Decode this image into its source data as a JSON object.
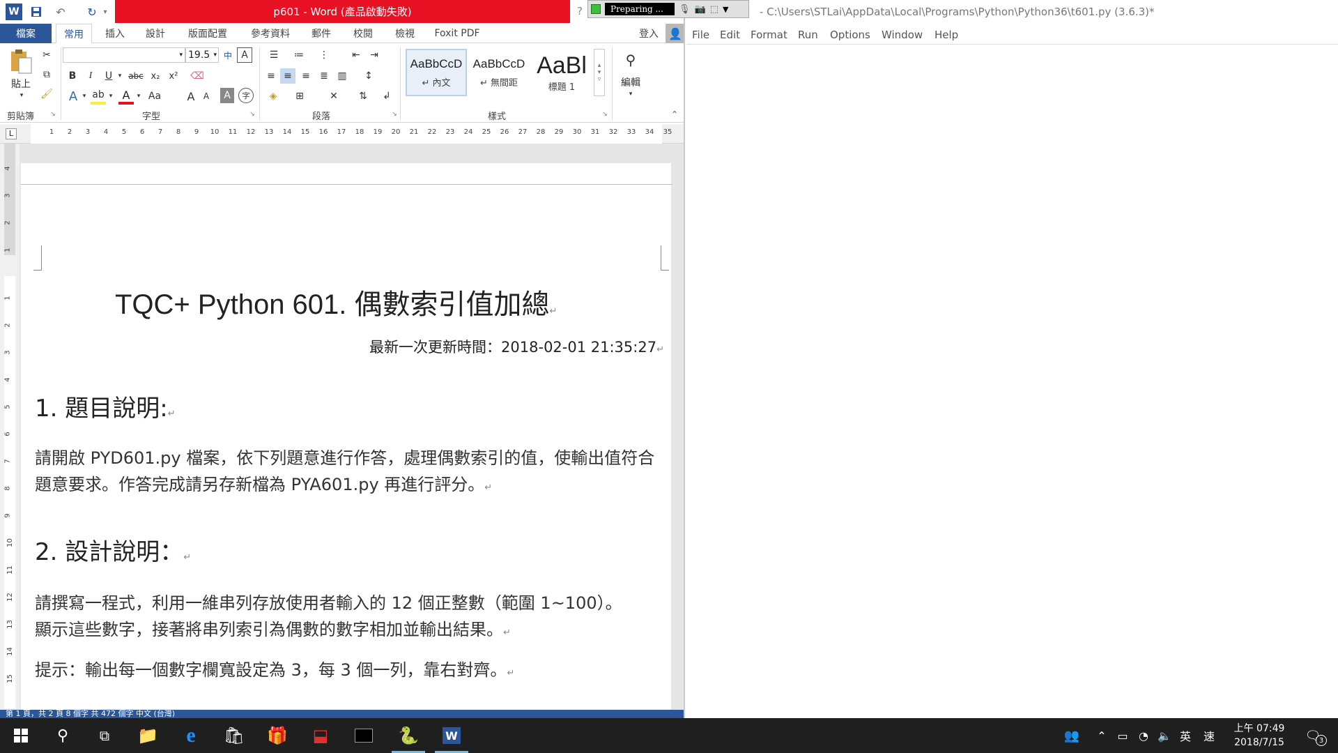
{
  "word": {
    "title": "p601 - Word (產品啟動失敗)",
    "help": "?",
    "tabs": [
      "檔案",
      "常用",
      "插入",
      "設計",
      "版面配置",
      "參考資料",
      "郵件",
      "校閱",
      "檢視",
      "Foxit PDF"
    ],
    "signin": "登入",
    "ribbon": {
      "paste_label": "貼上",
      "clipboard_label": "剪貼簿",
      "font_label": "字型",
      "paragraph_label": "段落",
      "styles_label": "樣式",
      "edit_label": "編輯",
      "font_name": "",
      "font_size": "19.5",
      "bold": "B",
      "italic": "I",
      "underline": "U",
      "strike": "abc",
      "subscript": "x₂",
      "superscript": "x²",
      "grow": "A",
      "shrink": "A",
      "case": "Aa",
      "styles": [
        {
          "sample": "AaBbCcD",
          "name": "↵ 內文"
        },
        {
          "sample": "AaBbCcD",
          "name": "↵ 無間距"
        },
        {
          "sample": "AaBl",
          "name": "標題 1"
        }
      ]
    },
    "ruler_marks": [
      "1",
      "2",
      "3",
      "4",
      "5",
      "6",
      "7",
      "8",
      "9",
      "10",
      "11",
      "12",
      "13",
      "14",
      "15",
      "16",
      "17",
      "18",
      "19",
      "20",
      "21",
      "22",
      "23",
      "24",
      "25",
      "26",
      "27",
      "28",
      "29",
      "30",
      "31",
      "32",
      "33",
      "34",
      "35"
    ],
    "ruler_left_marks": [
      "4",
      "3",
      "2",
      "1",
      "1",
      "2",
      "3",
      "4",
      "5",
      "6",
      "7",
      "8",
      "9",
      "10",
      "11",
      "12",
      "13",
      "14",
      "15"
    ],
    "status_text": "第 1 頁，共 2 頁    8 個字    共 472 個字    中文 (台灣)"
  },
  "document": {
    "title": "TQC+ Python 601.  偶數索引值加總",
    "update": "最新一次更新時間：2018-02-01 21:35:27",
    "h1": "1.  題目說明:",
    "p1": "請開啟 PYD601.py 檔案，依下列題意進行作答，處理偶數索引的值，使輸出值符合題意要求。作答完成請另存新檔為 PYA601.py 再進行評分。",
    "h2": "2.  設計說明：",
    "p2": "請撰寫一程式，利用一維串列存放使用者輸入的 12 個正整數（範圍 1~100）。顯示這些數字，接著將串列索引為偶數的數字相加並輸出結果。",
    "p3": "提示：輸出每一個數字欄寬設定為 3，每 3 個一列，靠右對齊。",
    "pilcrow": "↵"
  },
  "recorder": {
    "status": "Preparing ..."
  },
  "idle": {
    "title": "- C:\\Users\\STLai\\AppData\\Local\\Programs\\Python\\Python36\\t601.py (3.6.3)*",
    "menu": [
      "File",
      "Edit",
      "Format",
      "Run",
      "Options",
      "Window",
      "Help"
    ]
  },
  "taskbar": {
    "ime_lang": "英",
    "ime_mode": "速",
    "time": "上午 07:49",
    "date": "2018/7/15",
    "notifications": "3",
    "accent": "#76b9ed"
  }
}
